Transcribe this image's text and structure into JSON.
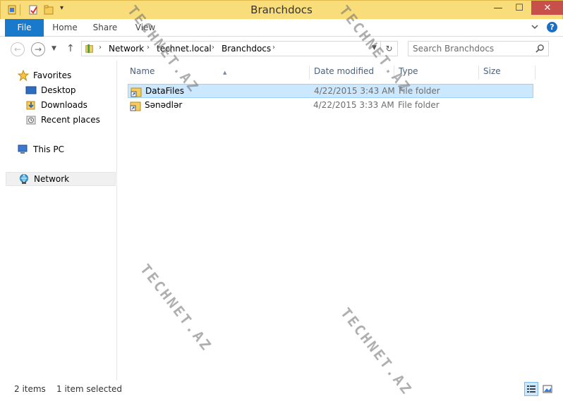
{
  "window": {
    "title": "Branchdocs",
    "controls": {
      "minimize": "—",
      "maximize": "☐",
      "close": "✕"
    }
  },
  "ribbon": {
    "tabs": [
      {
        "label": "File",
        "active": true
      },
      {
        "label": "Home"
      },
      {
        "label": "Share"
      },
      {
        "label": "View"
      }
    ],
    "help": "?"
  },
  "address": {
    "crumbs": [
      "Network",
      "technet.local",
      "Branchdocs"
    ],
    "search_placeholder": "Search Branchdocs"
  },
  "nav_pane": {
    "favorites": "Favorites",
    "desktop": "Desktop",
    "downloads": "Downloads",
    "recent": "Recent places",
    "thispc": "This PC",
    "network": "Network"
  },
  "columns": [
    "Name",
    "Date modified",
    "Type",
    "Size"
  ],
  "files": [
    {
      "name": "DataFiles",
      "date": "4/22/2015 3:43 AM",
      "type": "File folder",
      "selected": true
    },
    {
      "name": "Sənədlər",
      "date": "4/22/2015 3:33 AM",
      "type": "File folder",
      "selected": false
    }
  ],
  "status": {
    "items": "2 items",
    "selected": "1 item selected"
  },
  "watermark": "TECHNET.AZ",
  "colors": {
    "titlebar": "#f9dd7a",
    "file_tab": "#1979ca",
    "selection": "#cce8ff",
    "close": "#c7504b"
  }
}
